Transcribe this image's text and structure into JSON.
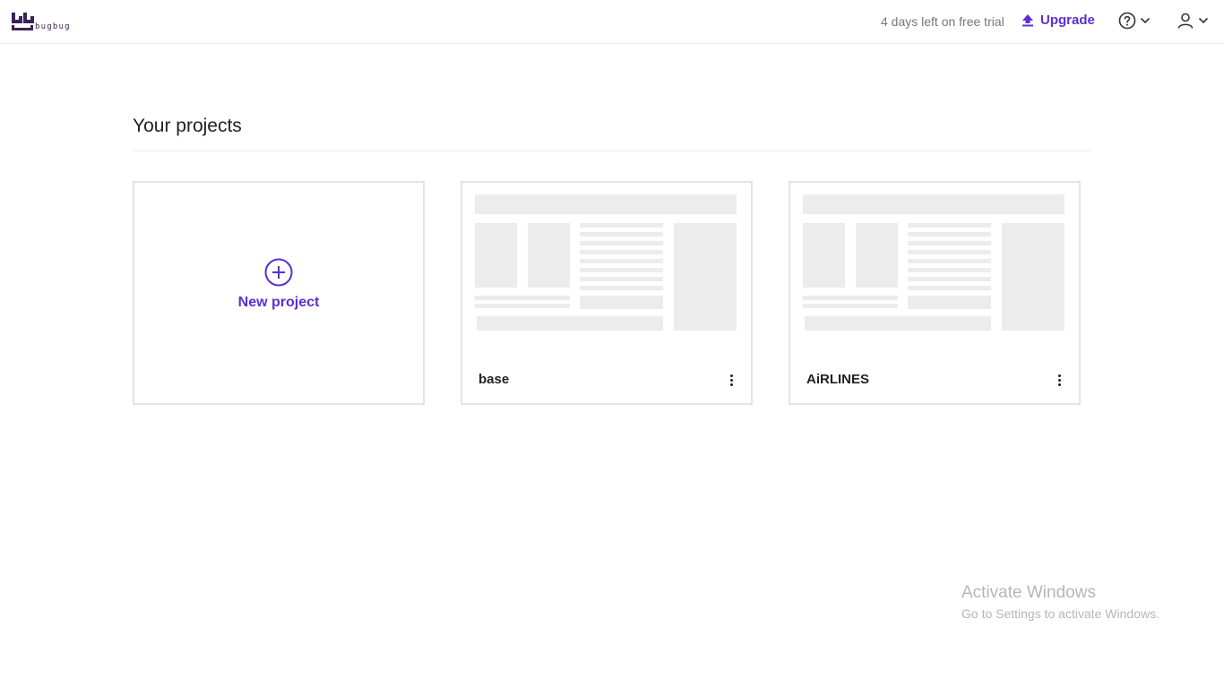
{
  "header": {
    "logo_text": "bugbug",
    "trial_text": "4 days left on free trial",
    "upgrade_label": "Upgrade"
  },
  "section": {
    "title": "Your projects"
  },
  "new_project": {
    "label": "New project"
  },
  "projects": [
    {
      "name": "base"
    },
    {
      "name": "AiRLINES"
    }
  ],
  "watermark": {
    "title": "Activate Windows",
    "subtitle": "Go to Settings to activate Windows."
  },
  "colors": {
    "accent": "#5b2fd4",
    "brand": "#3b2357",
    "placeholder": "#ececec"
  }
}
